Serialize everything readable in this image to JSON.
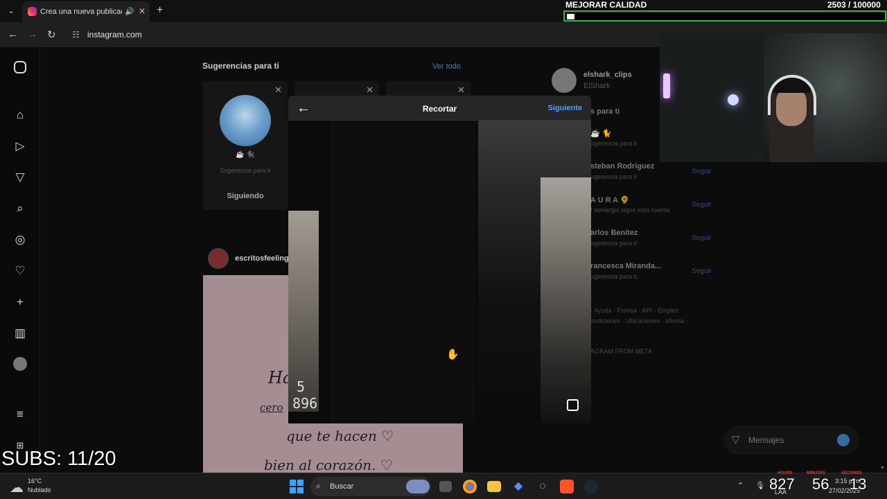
{
  "browser": {
    "tab_title": "Crea una nueva publicación",
    "url": "instagram.com"
  },
  "overlay": {
    "goal_label": "MEJORAR CALIDAD",
    "goal_count": "2503  / 100000",
    "goal_progress": 0.025,
    "subs": "SUBS: 11/20",
    "clock": {
      "hours": "827",
      "minutes": "56",
      "seconds": "13",
      "hours_label": "HOURS",
      "minutes_label": "MINUTES",
      "seconds_label": "SECONDS"
    }
  },
  "feed": {
    "suggestions_title": "Sugerencias para ti",
    "see_all": "Ver todo",
    "card": {
      "emoji": "☕ 🐈‍⬛",
      "subtitle": "Sugerencia para ti",
      "follow_label": "Siguiendo"
    },
    "post": {
      "author": "escritosfeeling",
      "line1": "Ha",
      "line2": "cero",
      "line3": "que te hacen ♡",
      "line4": "bien al corazón. ♡"
    }
  },
  "sidebar": {
    "user": {
      "username": "elshark_clips",
      "name": "ElShark"
    },
    "suggestions_label": "s para ti",
    "suggestions": [
      {
        "name": "☕ 🐈",
        "sub": "ugerencia para ti",
        "follow": ""
      },
      {
        "name": "steban Rodriguez",
        "sub": "ugerencia para ti",
        "follow": "Seguir"
      },
      {
        "name": "A U R A 🌻",
        "sub": "/ xomergix sigue esta cuenta",
        "follow": "Seguir"
      },
      {
        "name": "arlos Benitez",
        "sub": "ugerencia para ti",
        "follow": "Seguir"
      },
      {
        "name": "rancesca Miranda...",
        "sub": "ugerencia para ti",
        "follow": "Seguir"
      }
    ],
    "footer_line1": "· Ayuda · Prensa · API · Empleo ·",
    "footer_line2": "ondiciones · Ubicaciones · Idioma ·",
    "footer_line3": "AGRAM FROM META"
  },
  "modal": {
    "title": "Recortar",
    "next_label": "Siguiente",
    "photo_digits_1": "5",
    "photo_digits_2": "896"
  },
  "messages": {
    "label": "Mensajes"
  },
  "taskbar": {
    "weather_temp": "16°C",
    "weather_cond": "Nublado",
    "search_label": "Buscar",
    "lang": "LAA",
    "time": "3:15 p.m.",
    "date": "27/02/2025"
  }
}
